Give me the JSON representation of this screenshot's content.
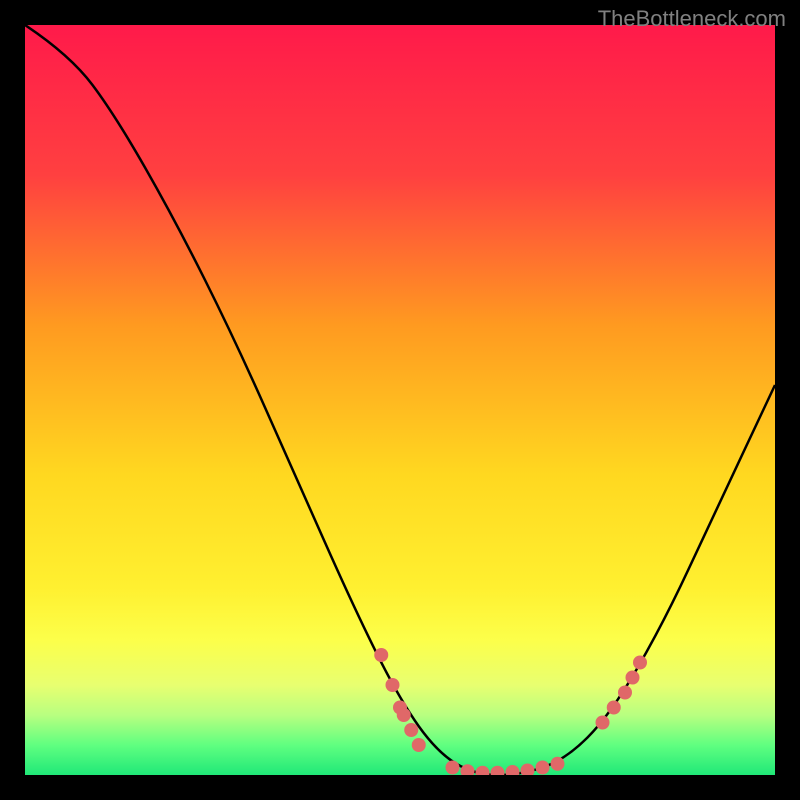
{
  "watermark": "TheBottleneck.com",
  "chart_data": {
    "type": "line",
    "title": "",
    "xlabel": "",
    "ylabel": "",
    "xlim": [
      0,
      100
    ],
    "ylim": [
      0,
      100
    ],
    "gradient_stops": [
      {
        "offset": 0,
        "color": "#ff1a4a"
      },
      {
        "offset": 20,
        "color": "#ff4040"
      },
      {
        "offset": 40,
        "color": "#ff9a20"
      },
      {
        "offset": 60,
        "color": "#ffd820"
      },
      {
        "offset": 75,
        "color": "#fff030"
      },
      {
        "offset": 82,
        "color": "#fcff4a"
      },
      {
        "offset": 88,
        "color": "#e8ff70"
      },
      {
        "offset": 92,
        "color": "#b8ff80"
      },
      {
        "offset": 96,
        "color": "#60ff80"
      },
      {
        "offset": 100,
        "color": "#20e878"
      }
    ],
    "curve": [
      {
        "x": 0,
        "y": 100
      },
      {
        "x": 6,
        "y": 96
      },
      {
        "x": 12,
        "y": 88
      },
      {
        "x": 20,
        "y": 74
      },
      {
        "x": 28,
        "y": 58
      },
      {
        "x": 36,
        "y": 40
      },
      {
        "x": 44,
        "y": 22
      },
      {
        "x": 50,
        "y": 10
      },
      {
        "x": 55,
        "y": 3
      },
      {
        "x": 60,
        "y": 0
      },
      {
        "x": 66,
        "y": 0
      },
      {
        "x": 72,
        "y": 2
      },
      {
        "x": 78,
        "y": 8
      },
      {
        "x": 85,
        "y": 20
      },
      {
        "x": 92,
        "y": 35
      },
      {
        "x": 100,
        "y": 52
      }
    ],
    "points": [
      {
        "x": 47.5,
        "y": 16
      },
      {
        "x": 49,
        "y": 12
      },
      {
        "x": 50,
        "y": 9
      },
      {
        "x": 50.5,
        "y": 8
      },
      {
        "x": 51.5,
        "y": 6
      },
      {
        "x": 52.5,
        "y": 4
      },
      {
        "x": 57,
        "y": 1
      },
      {
        "x": 59,
        "y": 0.5
      },
      {
        "x": 61,
        "y": 0.3
      },
      {
        "x": 63,
        "y": 0.3
      },
      {
        "x": 65,
        "y": 0.4
      },
      {
        "x": 67,
        "y": 0.6
      },
      {
        "x": 69,
        "y": 1
      },
      {
        "x": 71,
        "y": 1.5
      },
      {
        "x": 77,
        "y": 7
      },
      {
        "x": 78.5,
        "y": 9
      },
      {
        "x": 80,
        "y": 11
      },
      {
        "x": 81,
        "y": 13
      },
      {
        "x": 82,
        "y": 15
      }
    ],
    "point_color": "#e06868",
    "point_radius": 7
  }
}
